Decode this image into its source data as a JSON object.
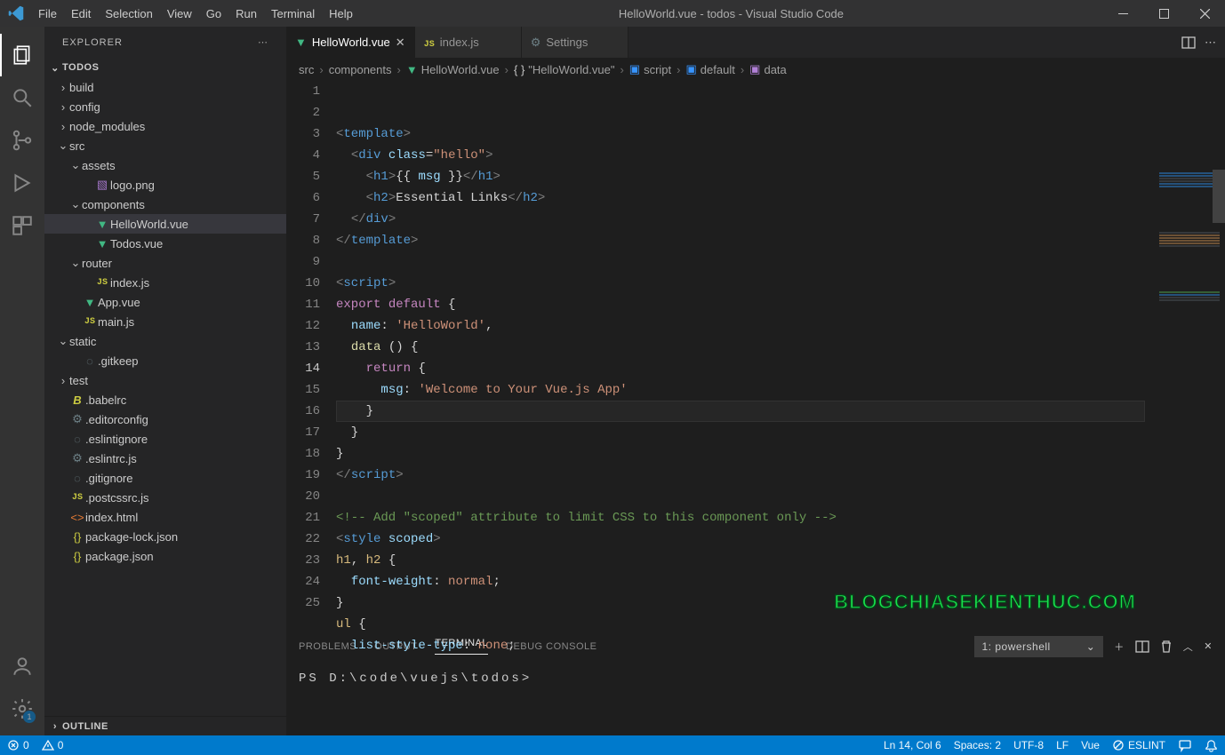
{
  "window": {
    "title": "HelloWorld.vue - todos - Visual Studio Code"
  },
  "menu": [
    "File",
    "Edit",
    "Selection",
    "View",
    "Go",
    "Run",
    "Terminal",
    "Help"
  ],
  "activityBadge": "1",
  "sidebar": {
    "title": "EXPLORER",
    "section": "TODOS",
    "outline": "OUTLINE",
    "tree": [
      {
        "type": "folder",
        "open": false,
        "depth": 0,
        "label": "build"
      },
      {
        "type": "folder",
        "open": false,
        "depth": 0,
        "label": "config"
      },
      {
        "type": "folder",
        "open": false,
        "depth": 0,
        "label": "node_modules"
      },
      {
        "type": "folder",
        "open": true,
        "depth": 0,
        "label": "src"
      },
      {
        "type": "folder",
        "open": true,
        "depth": 1,
        "label": "assets"
      },
      {
        "type": "file",
        "icon": "img",
        "depth": 2,
        "label": "logo.png"
      },
      {
        "type": "folder",
        "open": true,
        "depth": 1,
        "label": "components"
      },
      {
        "type": "file",
        "icon": "vue",
        "depth": 2,
        "label": "HelloWorld.vue",
        "selected": true
      },
      {
        "type": "file",
        "icon": "vue",
        "depth": 2,
        "label": "Todos.vue"
      },
      {
        "type": "folder",
        "open": true,
        "depth": 1,
        "label": "router"
      },
      {
        "type": "file",
        "icon": "js",
        "depth": 2,
        "label": "index.js"
      },
      {
        "type": "file",
        "icon": "vue",
        "depth": 1,
        "label": "App.vue"
      },
      {
        "type": "file",
        "icon": "js",
        "depth": 1,
        "label": "main.js"
      },
      {
        "type": "folder",
        "open": true,
        "depth": 0,
        "label": "static"
      },
      {
        "type": "file",
        "icon": "dot",
        "depth": 1,
        "label": ".gitkeep"
      },
      {
        "type": "folder",
        "open": false,
        "depth": 0,
        "label": "test"
      },
      {
        "type": "file",
        "icon": "babel",
        "depth": 0,
        "label": ".babelrc"
      },
      {
        "type": "file",
        "icon": "cfg",
        "depth": 0,
        "label": ".editorconfig"
      },
      {
        "type": "file",
        "icon": "dot",
        "depth": 0,
        "label": ".eslintignore"
      },
      {
        "type": "file",
        "icon": "cfg",
        "depth": 0,
        "label": ".eslintrc.js"
      },
      {
        "type": "file",
        "icon": "dot",
        "depth": 0,
        "label": ".gitignore"
      },
      {
        "type": "file",
        "icon": "js",
        "depth": 0,
        "label": ".postcssrc.js"
      },
      {
        "type": "file",
        "icon": "html",
        "depth": 0,
        "label": "index.html"
      },
      {
        "type": "file",
        "icon": "json",
        "depth": 0,
        "label": "package-lock.json"
      },
      {
        "type": "file",
        "icon": "json",
        "depth": 0,
        "label": "package.json"
      }
    ]
  },
  "tabs": [
    {
      "icon": "vue",
      "label": "HelloWorld.vue",
      "active": true,
      "close": true
    },
    {
      "icon": "js",
      "label": "index.js",
      "active": false
    },
    {
      "icon": "gear",
      "label": "Settings",
      "active": false
    }
  ],
  "breadcrumb": [
    {
      "icon": "",
      "label": "src"
    },
    {
      "icon": "",
      "label": "components"
    },
    {
      "icon": "vue",
      "label": "HelloWorld.vue"
    },
    {
      "icon": "braces",
      "label": "\"HelloWorld.vue\""
    },
    {
      "icon": "cube-blue",
      "label": "script"
    },
    {
      "icon": "cube-blue",
      "label": "default"
    },
    {
      "icon": "cube-purple",
      "label": "data"
    }
  ],
  "code": {
    "current": 14,
    "lines": [
      {
        "n": 1,
        "html": "<span class='tok-punc'>&lt;</span><span class='tok-tag'>template</span><span class='tok-punc'>&gt;</span>"
      },
      {
        "n": 2,
        "html": "  <span class='tok-punc'>&lt;</span><span class='tok-tag'>div</span> <span class='tok-attr'>class</span>=<span class='tok-str'>\"hello\"</span><span class='tok-punc'>&gt;</span>"
      },
      {
        "n": 3,
        "html": "    <span class='tok-punc'>&lt;</span><span class='tok-tag'>h1</span><span class='tok-punc'>&gt;</span>{{ <span class='tok-id'>msg</span> }}<span class='tok-punc'>&lt;/</span><span class='tok-tag'>h1</span><span class='tok-punc'>&gt;</span>"
      },
      {
        "n": 4,
        "html": "    <span class='tok-punc'>&lt;</span><span class='tok-tag'>h2</span><span class='tok-punc'>&gt;</span>Essential Links<span class='tok-punc'>&lt;/</span><span class='tok-tag'>h2</span><span class='tok-punc'>&gt;</span>"
      },
      {
        "n": 5,
        "html": "  <span class='tok-punc'>&lt;/</span><span class='tok-tag'>div</span><span class='tok-punc'>&gt;</span>"
      },
      {
        "n": 6,
        "html": "<span class='tok-punc'>&lt;/</span><span class='tok-tag'>template</span><span class='tok-punc'>&gt;</span>"
      },
      {
        "n": 7,
        "html": ""
      },
      {
        "n": 8,
        "html": "<span class='tok-punc'>&lt;</span><span class='tok-tag'>script</span><span class='tok-punc'>&gt;</span>"
      },
      {
        "n": 9,
        "html": "<span class='tok-kw'>export</span> <span class='tok-kw'>default</span> {"
      },
      {
        "n": 10,
        "html": "  <span class='tok-id'>name</span>: <span class='tok-str'>'HelloWorld'</span>,"
      },
      {
        "n": 11,
        "html": "  <span class='tok-fn'>data</span> () {"
      },
      {
        "n": 12,
        "html": "    <span class='tok-kw'>return</span> {"
      },
      {
        "n": 13,
        "html": "      <span class='tok-id'>msg</span>: <span class='tok-str'>'Welcome to Your Vue.js App'</span>"
      },
      {
        "n": 14,
        "html": "    }"
      },
      {
        "n": 15,
        "html": "  }"
      },
      {
        "n": 16,
        "html": "}"
      },
      {
        "n": 17,
        "html": "<span class='tok-punc'>&lt;/</span><span class='tok-tag'>script</span><span class='tok-punc'>&gt;</span>"
      },
      {
        "n": 18,
        "html": ""
      },
      {
        "n": 19,
        "html": "<span class='tok-comment'>&lt;!-- Add \"scoped\" attribute to limit CSS to this component only --&gt;</span>"
      },
      {
        "n": 20,
        "html": "<span class='tok-punc'>&lt;</span><span class='tok-tag'>style</span> <span class='tok-attr'>scoped</span><span class='tok-punc'>&gt;</span>"
      },
      {
        "n": 21,
        "html": "<span class='tok-sel'>h1</span>, <span class='tok-sel'>h2</span> {"
      },
      {
        "n": 22,
        "html": "  <span class='tok-id'>font-weight</span>: <span class='tok-str'>normal</span>;"
      },
      {
        "n": 23,
        "html": "}"
      },
      {
        "n": 24,
        "html": "<span class='tok-sel'>ul</span> {"
      },
      {
        "n": 25,
        "html": "  <span class='tok-id'>list-style-type</span>: <span class='tok-str'>none</span>;"
      }
    ]
  },
  "panel": {
    "tabs": [
      "PROBLEMS",
      "OUTPUT",
      "TERMINAL",
      "DEBUG CONSOLE"
    ],
    "active": 2,
    "termSelect": "1: powershell",
    "prompt": "PS D:\\code\\vuejs\\todos>"
  },
  "status": {
    "errors": "0",
    "warnings": "0",
    "pos": "Ln 14, Col 6",
    "spaces": "Spaces: 2",
    "enc": "UTF-8",
    "eol": "LF",
    "lang": "Vue",
    "eslint": "ESLINT"
  },
  "watermark": "BLOGCHIASEKIENTHUC.COM"
}
